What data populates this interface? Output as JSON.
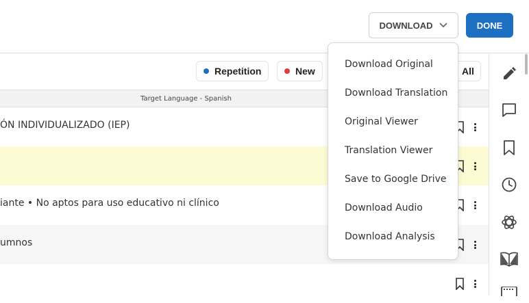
{
  "header": {
    "download_label": "DOWNLOAD",
    "done_label": "DONE"
  },
  "legend": {
    "repetition": {
      "label": "Repetition",
      "color": "#1d6fc1"
    },
    "new": {
      "label": "New",
      "color": "#e53945"
    },
    "all_label": "All"
  },
  "column_header": "Target Language - Spanish",
  "rows": [
    {
      "text": "ÓN INDIVIDUALIZADO (IEP)",
      "bg": "#ffffff"
    },
    {
      "text": "",
      "bg": "#fdfbd3"
    },
    {
      "text": "iante • No aptos para uso educativo ni clínico",
      "bg": "#ffffff"
    },
    {
      "text": "umnos",
      "bg": "#f6f6f6"
    },
    {
      "text": "",
      "bg": "#ffffff"
    }
  ],
  "dropdown": {
    "items": [
      "Download Original",
      "Download Translation",
      "Original Viewer",
      "Translation Viewer",
      "Save to Google Drive",
      "Download Audio",
      "Download Analysis"
    ]
  },
  "sidebar": {
    "icons": [
      "pencil-icon",
      "comment-icon",
      "bookmark-icon",
      "history-icon",
      "ai-icon",
      "book-icon",
      "keyboard-icon"
    ]
  }
}
